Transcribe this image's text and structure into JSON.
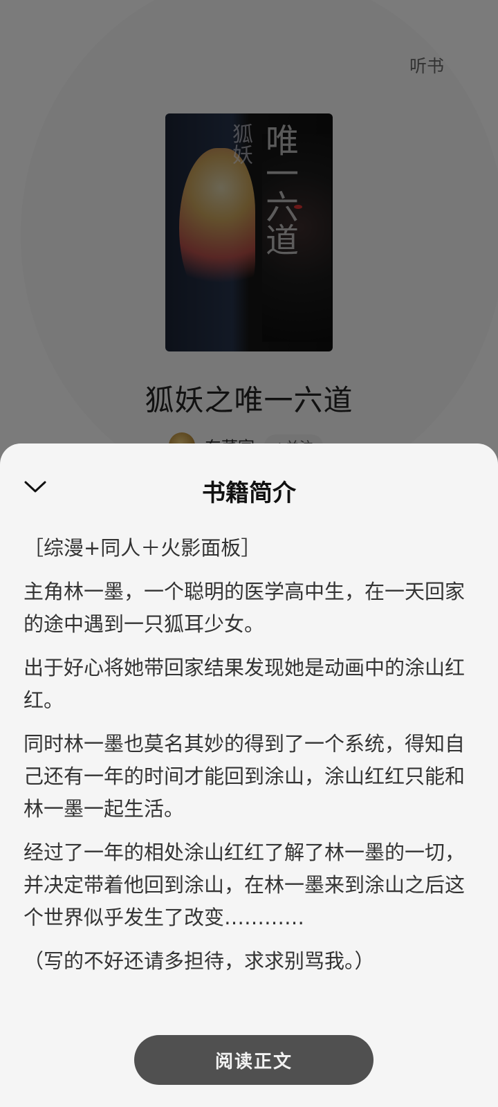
{
  "header": {
    "listen_label": "听书"
  },
  "book": {
    "cover_title_left": "狐妖",
    "cover_title_right": "唯一六道",
    "title": "狐妖之唯一六道",
    "author": "东蕃宴",
    "follow_label": "+关注"
  },
  "sheet": {
    "title": "书籍简介",
    "paragraphs": [
      "［综漫+同人＋火影面板］",
      "主角林一墨，一个聪明的医学高中生，在一天回家的途中遇到一只狐耳少女。",
      "出于好心将她带回家结果发现她是动画中的涂山红红。",
      "同时林一墨也莫名其妙的得到了一个系统，得知自己还有一年的时间才能回到涂山，涂山红红只能和林一墨一起生活。",
      "经过了一年的相处涂山红红了解了林一墨的一切，并决定带着他回到涂山，在林一墨来到涂山之后这个世界似乎发生了改变…………",
      "（写的不好还请多担待，求求别骂我。）"
    ],
    "read_button_label": "阅读正文"
  },
  "colors": {
    "sheet_bg": "#f5f5f5",
    "button_bg": "#505050",
    "overlay": "rgba(0,0,0,0.5)"
  }
}
